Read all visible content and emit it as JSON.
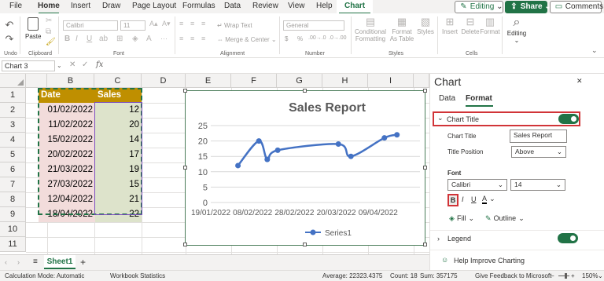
{
  "menu": {
    "tabs": [
      "File",
      "Home",
      "Insert",
      "Draw",
      "Page Layout",
      "Formulas",
      "Data",
      "Review",
      "View",
      "Help",
      "Chart"
    ],
    "active": "Home",
    "editing_label": "Editing",
    "share_label": "Share",
    "comments_label": "Comments"
  },
  "ribbon": {
    "undo_label": "Undo",
    "paste_label": "Paste",
    "clipboard_label": "Clipboard",
    "font_name": "Calibri",
    "font_size": "11",
    "font_label": "Font",
    "wrap_text": "Wrap Text",
    "merge_center": "Merge & Center",
    "alignment_label": "Alignment",
    "number_format": "General",
    "number_label": "Number",
    "conditional_formatting": "Conditional Formatting",
    "format_as_table": "Format As Table",
    "styles_button": "Styles",
    "styles_label": "Styles",
    "insert_label": "Insert",
    "delete_label": "Delete",
    "format_label": "Format",
    "cells_label": "Cells",
    "editing_label": "Editing",
    "currency_symbol": "$",
    "percent_symbol": "%",
    "decimal_more": ".00→.0",
    "decimal_less": ".0→.00"
  },
  "formula_bar": {
    "name_box": "Chart 3",
    "fx": "fx",
    "cancel": "✕",
    "confirm": "✓"
  },
  "grid": {
    "columns": [
      "B",
      "C",
      "D",
      "E",
      "F",
      "G",
      "H",
      "I"
    ],
    "rows": [
      "1",
      "2",
      "3",
      "4",
      "5",
      "6",
      "7",
      "8",
      "9",
      "10",
      "11"
    ],
    "header": {
      "date": "Date",
      "sales": "Sales"
    },
    "data": [
      {
        "date": "01/02/2022",
        "sales": "12"
      },
      {
        "date": "11/02/2022",
        "sales": "20"
      },
      {
        "date": "15/02/2022",
        "sales": "14"
      },
      {
        "date": "20/02/2022",
        "sales": "17"
      },
      {
        "date": "21/03/2022",
        "sales": "19"
      },
      {
        "date": "27/03/2022",
        "sales": "15"
      },
      {
        "date": "12/04/2022",
        "sales": "21"
      },
      {
        "date": "18/04/2022",
        "sales": "22"
      }
    ]
  },
  "chart_data": {
    "type": "line",
    "title": "Sales Report",
    "x": [
      "01/02/2022",
      "11/02/2022",
      "15/02/2022",
      "20/02/2022",
      "21/03/2022",
      "27/03/2022",
      "12/04/2022",
      "18/04/2022"
    ],
    "series": [
      {
        "name": "Series1",
        "values": [
          12,
          20,
          14,
          17,
          19,
          15,
          21,
          22
        ]
      }
    ],
    "y_ticks": [
      "0",
      "5",
      "10",
      "15",
      "20",
      "25"
    ],
    "ylim": [
      0,
      25
    ],
    "x_ticks": [
      "19/01/2022",
      "08/02/2022",
      "28/02/2022",
      "20/03/2022",
      "09/04/2022"
    ],
    "xlim": [
      "19/01/2022",
      "29/04/2022"
    ],
    "xlabel": "",
    "ylabel": "",
    "grid": true,
    "legend": "bottom",
    "smooth": true,
    "color": "#4472c4"
  },
  "sheets": {
    "tabs": [
      "Sheet1"
    ],
    "add": "+"
  },
  "status": {
    "calc_mode": "Calculation Mode: Automatic",
    "workbook_stats": "Workbook Statistics",
    "average": "Average: 22323.4375",
    "count": "Count: 18",
    "sum": "Sum: 357175",
    "feedback": "Give Feedback to Microsoft",
    "zoom": "150%",
    "zoom_minus": "−",
    "zoom_plus": "+"
  },
  "pane": {
    "title": "Chart",
    "tabs": [
      "Data",
      "Format"
    ],
    "active_tab": "Format",
    "section_chart_title": "Chart Title",
    "chart_title_label": "Chart Title",
    "chart_title_value": "Sales Report",
    "title_position_label": "Title Position",
    "title_position_value": "Above",
    "font_heading": "Font",
    "font_name": "Calibri",
    "font_size": "14",
    "bold": "B",
    "italic": "I",
    "underline": "U",
    "font_color": "A",
    "fill_label": "Fill",
    "outline_label": "Outline",
    "legend_label": "Legend",
    "help_label": "Help Improve Charting",
    "close": "✕"
  }
}
